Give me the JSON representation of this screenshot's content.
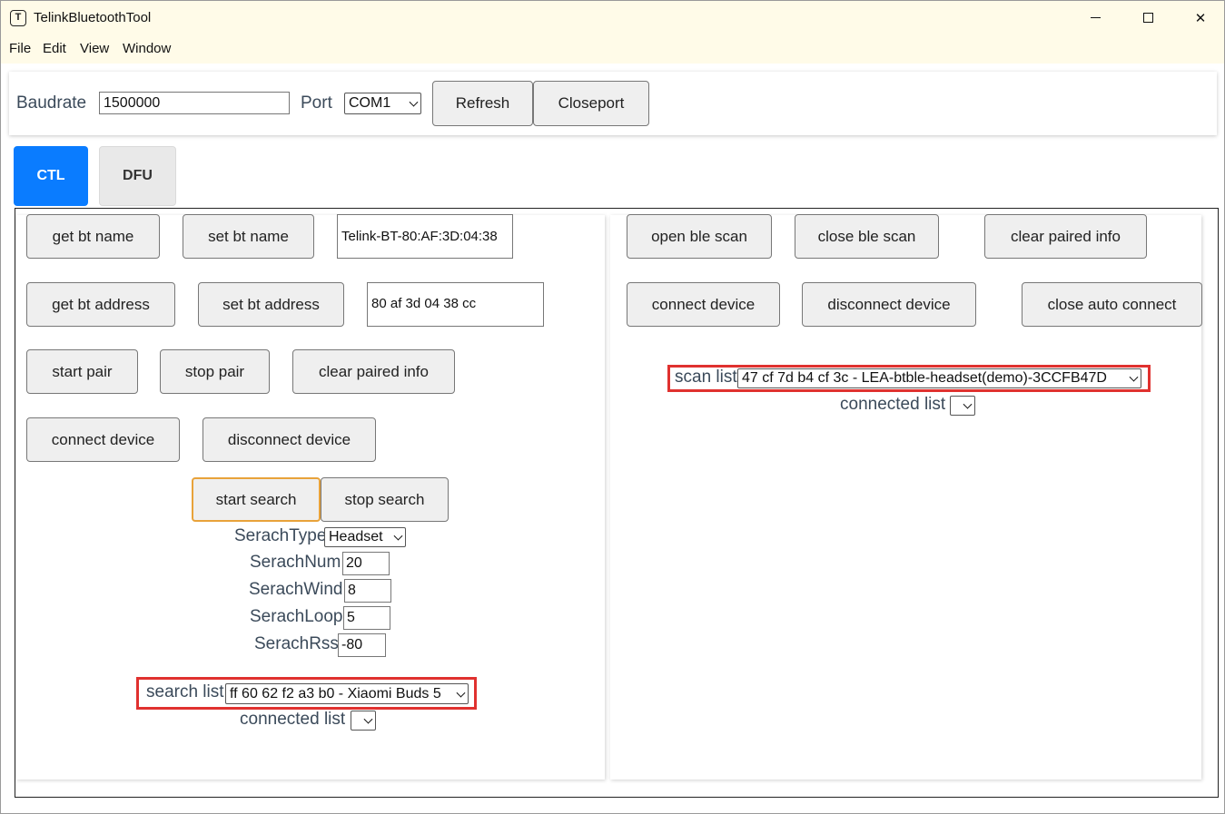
{
  "window": {
    "title": "TelinkBluetoothTool",
    "icon_letter": "T"
  },
  "menu": [
    "File",
    "Edit",
    "View",
    "Window"
  ],
  "connection": {
    "baudrate_label": "Baudrate",
    "baudrate_value": "1500000",
    "port_label": "Port",
    "port_value": "COM1",
    "refresh_label": "Refresh",
    "closeport_label": "Closeport"
  },
  "tabs": [
    {
      "label": "CTL",
      "active": true
    },
    {
      "label": "DFU",
      "active": false
    }
  ],
  "left": {
    "get_bt_name": "get bt name",
    "set_bt_name": "set bt name",
    "bt_name_value": "Telink-BT-80:AF:3D:04:38",
    "get_bt_address": "get bt address",
    "set_bt_address": "set bt address",
    "bt_address_value": "80 af 3d 04 38 cc",
    "start_pair": "start pair",
    "stop_pair": "stop pair",
    "clear_paired_info": "clear paired info",
    "connect_device": "connect device",
    "disconnect_device": "disconnect device",
    "start_search": "start search",
    "stop_search": "stop search",
    "search_type_label": "SerachType",
    "search_type_value": "Headset",
    "search_num_label": "SerachNum",
    "search_num_value": "20",
    "search_wind_label": "SerachWind",
    "search_wind_value": "8",
    "search_loop_label": "SerachLoop",
    "search_loop_value": "5",
    "search_rssi_label": "SerachRssi",
    "search_rssi_value": "-80",
    "search_list_label": "search list",
    "search_list_value": "ff 60 62 f2 a3 b0 - Xiaomi Buds 5",
    "connected_list_label": "connected list",
    "connected_list_value": ""
  },
  "right": {
    "open_ble_scan": "open ble scan",
    "close_ble_scan": "close ble scan",
    "clear_paired_info": "clear paired info",
    "connect_device": "connect device",
    "disconnect_device": "disconnect device",
    "close_auto_connect": "close auto connect",
    "scan_list_label": "scan list",
    "scan_list_value": "47 cf 7d b4 cf 3c - LEA-btble-headset(demo)-3CCFB47D",
    "connected_list_label": "connected list",
    "connected_list_value": ""
  },
  "colors": {
    "titlebar_bg": "#fffbe8",
    "active_tab": "#0a7cff",
    "highlight": "#e0312f",
    "focus_border": "#e8a23a"
  }
}
